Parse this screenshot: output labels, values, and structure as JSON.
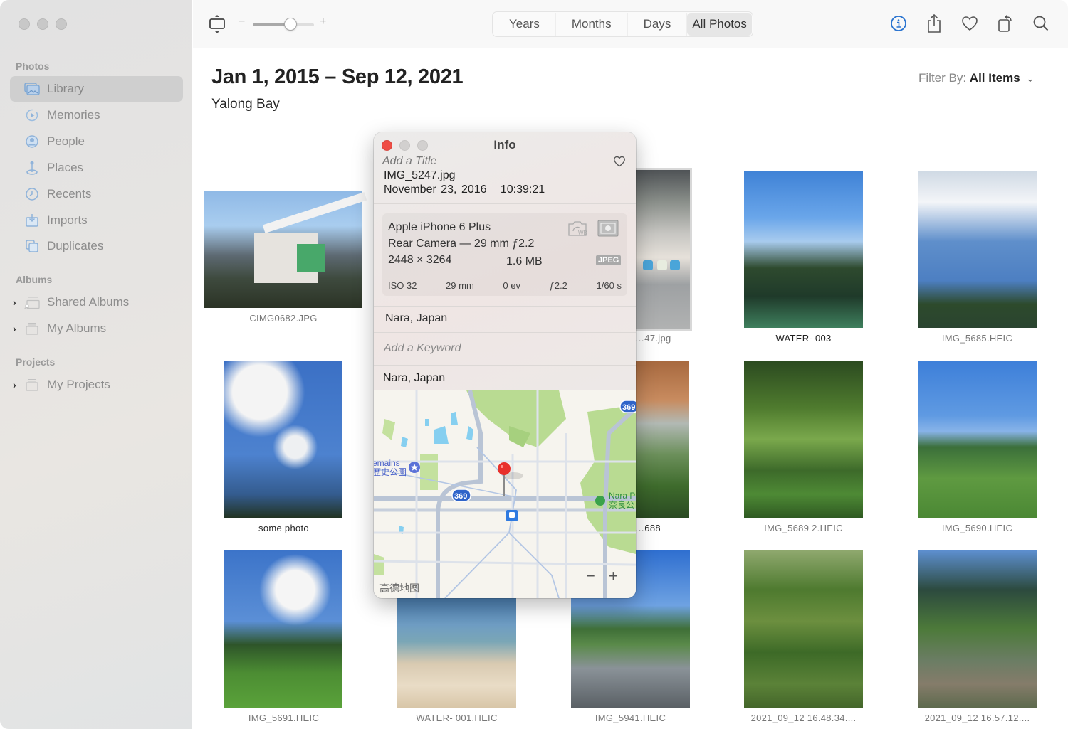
{
  "window": {
    "traffic_lights": [
      "close",
      "minimize",
      "zoom"
    ]
  },
  "sidebar": {
    "sections": [
      {
        "label": "Photos",
        "items": [
          {
            "label": "Library",
            "icon": "library-icon",
            "active": true
          },
          {
            "label": "Memories",
            "icon": "memories-icon"
          },
          {
            "label": "People",
            "icon": "people-icon"
          },
          {
            "label": "Places",
            "icon": "places-icon"
          },
          {
            "label": "Recents",
            "icon": "recents-icon"
          },
          {
            "label": "Imports",
            "icon": "imports-icon"
          },
          {
            "label": "Duplicates",
            "icon": "duplicates-icon"
          }
        ]
      },
      {
        "label": "Albums",
        "items": [
          {
            "label": "Shared Albums",
            "icon": "shared-albums-icon",
            "expandable": true
          },
          {
            "label": "My Albums",
            "icon": "album-stack-icon",
            "expandable": true
          }
        ]
      },
      {
        "label": "Projects",
        "items": [
          {
            "label": "My Projects",
            "icon": "album-stack-icon",
            "expandable": true
          }
        ]
      }
    ]
  },
  "toolbar": {
    "zoom_minus": "−",
    "zoom_plus": "+",
    "zoom_slider_value": 0.62,
    "view_tabs": [
      {
        "label": "Years"
      },
      {
        "label": "Months"
      },
      {
        "label": "Days"
      },
      {
        "label": "All Photos",
        "active": true
      }
    ],
    "actions": [
      "info-icon",
      "share-icon",
      "favorite-heart-icon",
      "rotate-icon",
      "search-icon"
    ],
    "accent_color": "#2a74d0"
  },
  "main": {
    "title": "Jan 1, 2015 – Sep 12, 2021",
    "subtitle": "Yalong Bay",
    "filter_label": "Filter By:",
    "filter_value": "All Items",
    "photos": [
      {
        "caption": "CIMG0682.JPG"
      },
      {
        "caption": "…47.jpg",
        "selected": true
      },
      {
        "caption": "WATER- 003"
      },
      {
        "caption": "IMG_5685.HEIC"
      },
      {
        "caption": "some photo"
      },
      {
        "caption": "…688"
      },
      {
        "caption": "IMG_5689 2.HEIC"
      },
      {
        "caption": "IMG_5690.HEIC"
      },
      {
        "caption": "IMG_5691.HEIC"
      },
      {
        "caption": "WATER- 001.HEIC"
      },
      {
        "caption": "IMG_5941.HEIC"
      },
      {
        "caption": "2021_09_12 16.48.34...."
      },
      {
        "caption": "2021_09_12 16.57.12...."
      }
    ]
  },
  "info_panel": {
    "title": "Info",
    "add_title_placeholder": "Add a Title",
    "filename": "IMG_5247.jpg",
    "date": "November 23, 2016",
    "time": "10:39:21",
    "camera": {
      "model": "Apple iPhone 6 Plus",
      "lens": "Rear Camera — 29 mm ƒ2.2",
      "dimensions": "2448 × 3264",
      "file_size": "1.6 MB",
      "format": "JPEG",
      "exif": [
        "ISO 32",
        "29 mm",
        "0 ev",
        "ƒ2.2",
        "1/60 s"
      ]
    },
    "location": "Nara, Japan",
    "keyword_placeholder": "Add a Keyword",
    "map_location": "Nara, Japan",
    "map": {
      "labels": {
        "remains": "emains",
        "park_jp": "歴史公園",
        "nara": "Nara P",
        "nara_jp": "奈良公",
        "route": "369",
        "route2": "369",
        "attribution": "高德地图"
      },
      "zoom_out": "−",
      "zoom_in": "+"
    }
  }
}
